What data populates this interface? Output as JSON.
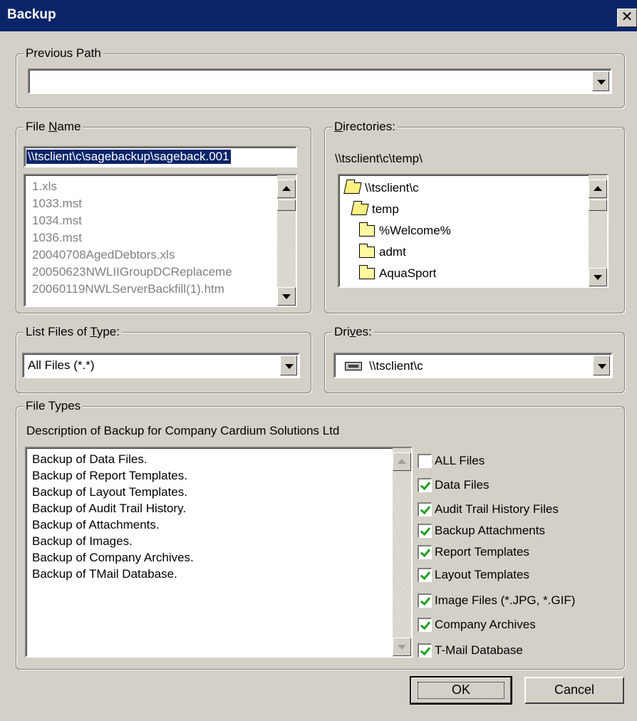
{
  "window": {
    "title": "Backup",
    "close_glyph": "✕"
  },
  "previous_path": {
    "label": "Previous Path",
    "value": ""
  },
  "file_name": {
    "label": "File Name",
    "value": "\\\\tsclient\\c\\sagebackup\\sageback.001",
    "files": [
      "1.xls",
      "1033.mst",
      "1034.mst",
      "1036.mst",
      "20040708AgedDebtors.xls",
      "20050623NWLIIGroupDCReplaceme",
      "20060119NWLServerBackfill(1).htm"
    ]
  },
  "directories": {
    "label": "Directories:",
    "current_path": "\\\\tsclient\\c\\temp\\",
    "items": [
      {
        "label": "\\\\tsclient\\c",
        "icon": "open-folder-icon"
      },
      {
        "label": "temp",
        "icon": "open-folder-icon"
      },
      {
        "label": "%Welcome%",
        "icon": "folder-icon"
      },
      {
        "label": "admt",
        "icon": "folder-icon"
      },
      {
        "label": "AquaSport",
        "icon": "folder-icon"
      }
    ]
  },
  "file_type": {
    "label": "List Files of Type:",
    "value": "All Files (*.*)"
  },
  "drives": {
    "label": "Drives:",
    "value": "\\\\tsclient\\c",
    "icon": "network-drive-icon"
  },
  "file_types": {
    "label": "File Types",
    "description": "Description of Backup for Company Cardium Solutions Ltd",
    "lines": [
      "Backup of Data Files.",
      "Backup of Report Templates.",
      "Backup of Layout Templates.",
      "Backup of Audit Trail History.",
      "Backup of Attachments.",
      "Backup of Images.",
      "Backup of Company Archives.",
      "Backup of TMail Database."
    ],
    "checkboxes": [
      {
        "label": "ALL Files",
        "checked": false
      },
      {
        "label": "Data Files",
        "checked": true
      },
      {
        "label": "Audit Trail History Files",
        "checked": true
      },
      {
        "label": "Backup Attachments",
        "checked": true
      },
      {
        "label": "Report Templates",
        "checked": true
      },
      {
        "label": "Layout Templates",
        "checked": true
      },
      {
        "label": "Image Files (*.JPG, *.GIF)",
        "checked": true
      },
      {
        "label": "Company Archives",
        "checked": true
      },
      {
        "label": "T-Mail Database",
        "checked": true
      }
    ]
  },
  "buttons": {
    "ok": "OK",
    "cancel": "Cancel"
  },
  "colors": {
    "titlebar": "#0a246a",
    "face": "#d4d0c8",
    "selection": "#0a246a",
    "check": "#20a020"
  }
}
